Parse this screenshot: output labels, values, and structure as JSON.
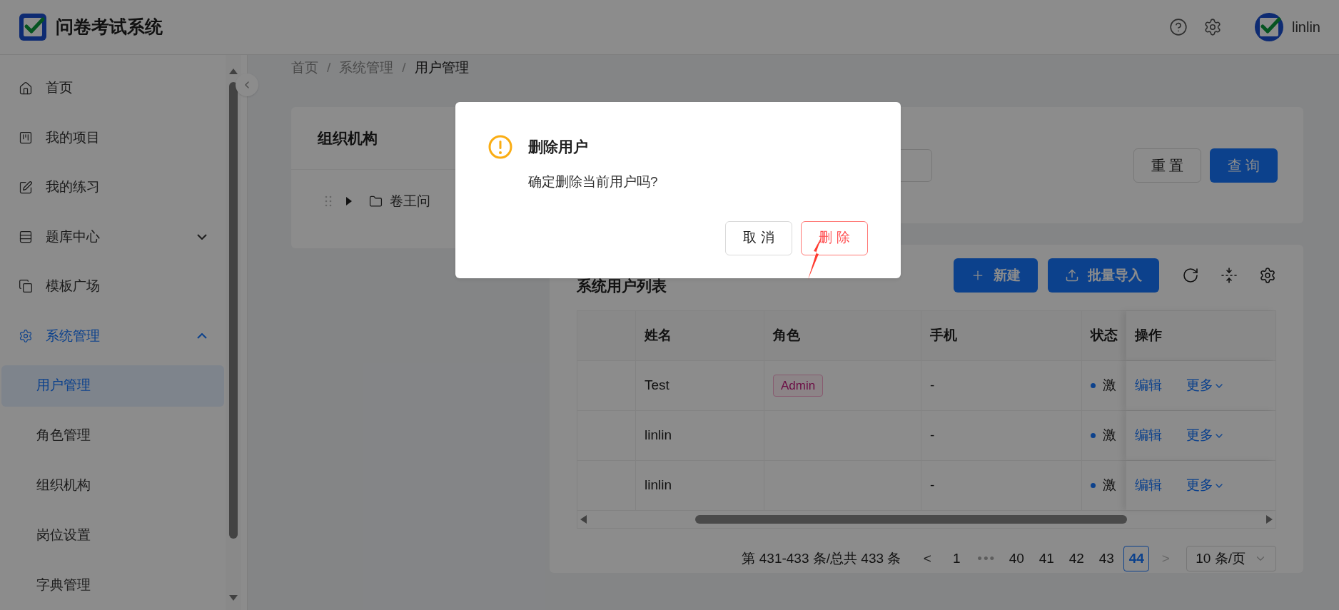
{
  "header": {
    "title": "问卷考试系统",
    "user": "linlin"
  },
  "sidebar": {
    "items": [
      {
        "label": "首页",
        "selected": false
      },
      {
        "label": "我的项目",
        "selected": false
      },
      {
        "label": "我的练习",
        "selected": false
      },
      {
        "label": "题库中心",
        "selected": false,
        "expanded": false
      },
      {
        "label": "模板广场",
        "selected": false
      },
      {
        "label": "系统管理",
        "selected": true,
        "expanded": true,
        "children": [
          {
            "label": "用户管理",
            "selected": true
          },
          {
            "label": "角色管理",
            "selected": false
          },
          {
            "label": "组织机构",
            "selected": false
          },
          {
            "label": "岗位设置",
            "selected": false
          },
          {
            "label": "字典管理",
            "selected": false
          }
        ]
      }
    ]
  },
  "breadcrumb": {
    "items": [
      "首页",
      "系统管理",
      "用户管理"
    ],
    "separators": [
      "/",
      "/"
    ]
  },
  "org_panel": {
    "title": "组织机构",
    "tree": [
      {
        "label": "卷王问",
        "expanded": false
      }
    ]
  },
  "search": {
    "buttons": [
      {
        "label": "重 置",
        "kind": "default"
      },
      {
        "label": "查 询",
        "kind": "primary"
      }
    ]
  },
  "table_card": {
    "title": "系统用户列表",
    "buttons": [
      {
        "label": "新建"
      },
      {
        "label": "批量导入"
      }
    ],
    "columns": [
      "",
      "姓名",
      "角色",
      "手机",
      "状态",
      "操作"
    ],
    "rows": [
      {
        "name": "Test",
        "role": "Admin",
        "phone": "-",
        "status": "激",
        "edit": "编辑",
        "more": "更多"
      },
      {
        "name": "linlin",
        "phone": "-",
        "status": "激",
        "edit": "编辑",
        "more": "更多"
      },
      {
        "name": "linlin",
        "phone": "-",
        "status": "激",
        "edit": "编辑",
        "more": "更多"
      }
    ]
  },
  "pagination": {
    "summary": "第 431-433 条/总共 433 条",
    "prev": "<",
    "next": ">",
    "pages": [
      {
        "label": "1",
        "kind": "page",
        "selected": false
      },
      {
        "label": "•••",
        "kind": "jump",
        "selected": false
      },
      {
        "label": "40",
        "kind": "page",
        "selected": false
      },
      {
        "label": "41",
        "kind": "page",
        "selected": false
      },
      {
        "label": "42",
        "kind": "page",
        "selected": false
      },
      {
        "label": "43",
        "kind": "page",
        "selected": false
      },
      {
        "label": "44",
        "kind": "page",
        "selected": true
      }
    ],
    "page_size": "10 条/页"
  },
  "dialog": {
    "title": "删除用户",
    "message": "确定删除当前用户吗?",
    "buttons": [
      {
        "label": "取 消",
        "kind": "default"
      },
      {
        "label": "删 除",
        "kind": "danger"
      }
    ]
  }
}
